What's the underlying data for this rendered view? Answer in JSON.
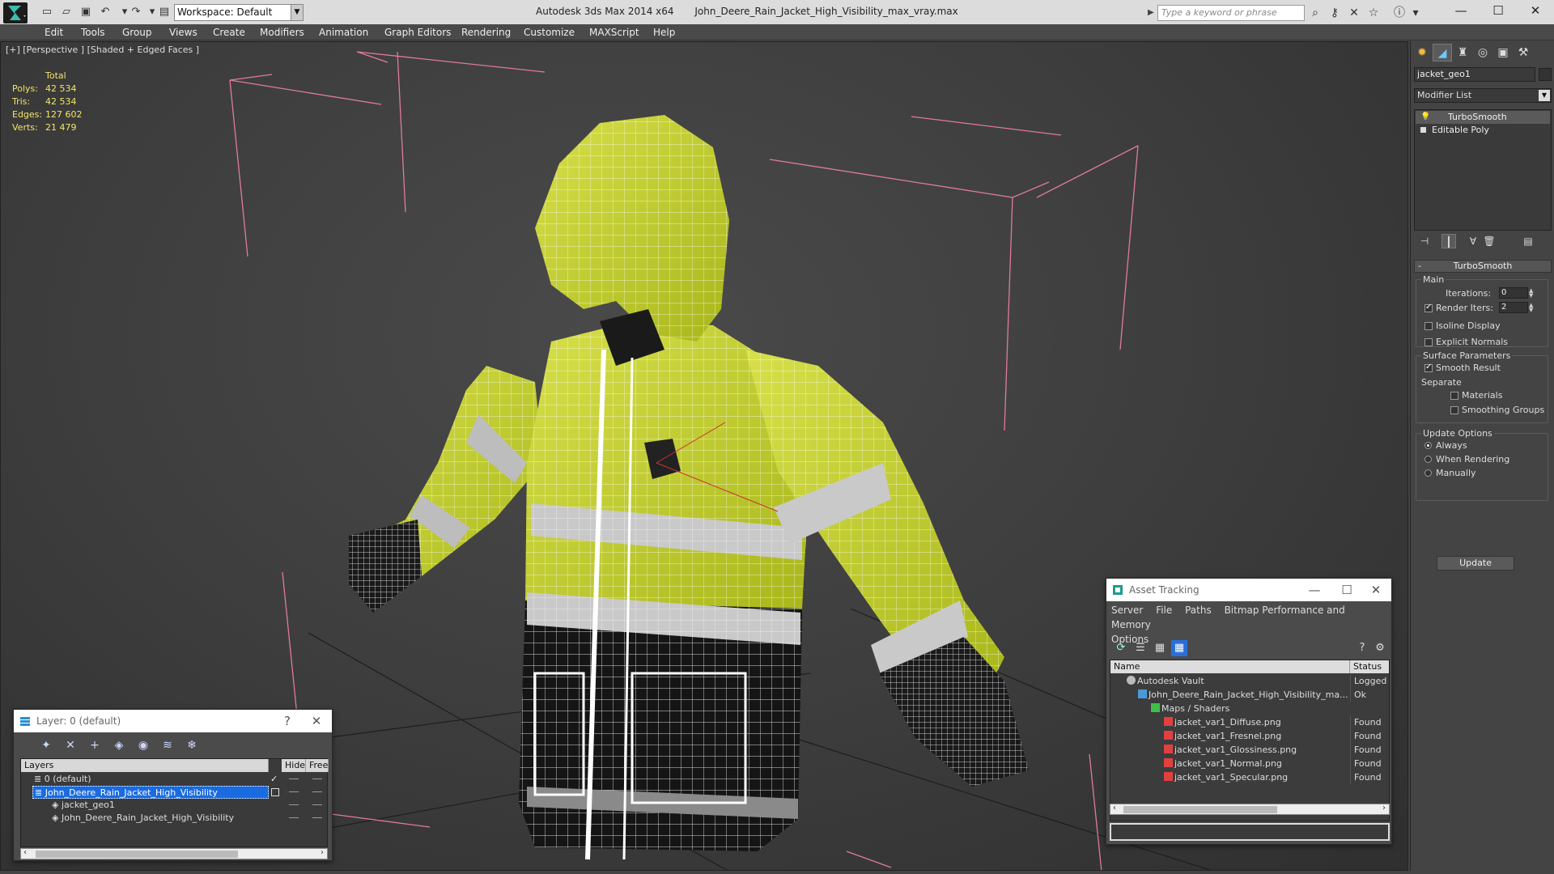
{
  "titlebar": {
    "workspace": "Workspace: Default",
    "app_name": "Autodesk 3ds Max  2014 x64",
    "file_name": "John_Deere_Rain_Jacket_High_Visibility_max_vray.max",
    "search_placeholder": "Type a keyword or phrase"
  },
  "menu": [
    "Edit",
    "Tools",
    "Group",
    "Views",
    "Create",
    "Modifiers",
    "Animation",
    "Graph Editors",
    "Rendering",
    "Customize",
    "MAXScript",
    "Help"
  ],
  "viewport": {
    "label": "[+] [Perspective ] [Shaded + Edged Faces ]",
    "stats": {
      "header": "Total",
      "rows": [
        {
          "label": "Polys:",
          "value": "42 534"
        },
        {
          "label": "Tris:",
          "value": "42 534"
        },
        {
          "label": "Edges:",
          "value": "127 602"
        },
        {
          "label": "Verts:",
          "value": "21 479"
        }
      ]
    }
  },
  "layer_dialog": {
    "title": "Layer: 0 (default)",
    "help": "?",
    "columns": [
      "Layers",
      "Hide",
      "Free"
    ],
    "rows": [
      {
        "name": "0 (default)"
      },
      {
        "name": "John_Deere_Rain_Jacket_High_Visibility"
      },
      {
        "name": "jacket_geo1"
      },
      {
        "name": "John_Deere_Rain_Jacket_High_Visibility"
      }
    ]
  },
  "asset_dialog": {
    "title": "Asset Tracking",
    "menu": [
      "Server",
      "File",
      "Paths",
      "Bitmap Performance and Memory",
      "Options"
    ],
    "columns": [
      "Name",
      "Status"
    ],
    "rows": [
      {
        "name": "Autodesk Vault",
        "status": "Logged"
      },
      {
        "name": "John_Deere_Rain_Jacket_High_Visibility_ma...",
        "status": "Ok"
      },
      {
        "name": "Maps / Shaders",
        "status": ""
      },
      {
        "name": "jacket_var1_Diffuse.png",
        "status": "Found"
      },
      {
        "name": "jacket_var1_Fresnel.png",
        "status": "Found"
      },
      {
        "name": "jacket_var1_Glossiness.png",
        "status": "Found"
      },
      {
        "name": "jacket_var1_Normal.png",
        "status": "Found"
      },
      {
        "name": "jacket_var1_Specular.png",
        "status": "Found"
      }
    ]
  },
  "command_panel": {
    "object_name": "jacket_geo1",
    "modifier_list": "Modifier List",
    "stack": [
      "TurboSmooth",
      "Editable Poly"
    ],
    "rollout_title": "TurboSmooth",
    "main_label": "Main",
    "iterations_label": "Iterations:",
    "iterations_value": "0",
    "render_iters_label": "Render Iters:",
    "render_iters_value": "2",
    "isoline_label": "Isoline Display",
    "explicit_normals_label": "Explicit Normals",
    "surface_params_label": "Surface Parameters",
    "smooth_result_label": "Smooth Result",
    "separate_label": "Separate",
    "materials_label": "Materials",
    "smoothing_groups_label": "Smoothing Groups",
    "update_options_label": "Update Options",
    "always_label": "Always",
    "when_rendering_label": "When Rendering",
    "manually_label": "Manually",
    "update_button": "Update"
  },
  "colors": {
    "jacket_yellow": "#c9d62a",
    "wire": "#ffffff",
    "bbox": "#e07aa0",
    "stats": "#f3e56a",
    "selection": "#1a6bdf"
  }
}
